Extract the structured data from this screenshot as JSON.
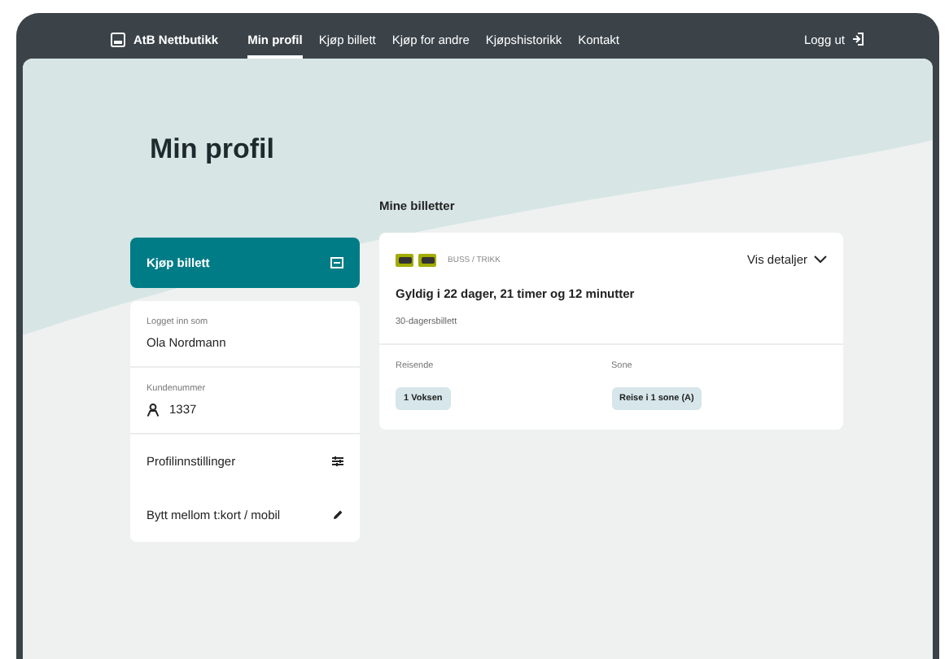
{
  "nav": {
    "brand": "AtB Nettbutikk",
    "links": [
      {
        "label": "Min profil",
        "selected": true
      },
      {
        "label": "Kjøp billett",
        "selected": false
      },
      {
        "label": "Kjøp for andre",
        "selected": false
      },
      {
        "label": "Kjøpshistorikk",
        "selected": false
      },
      {
        "label": "Kontakt",
        "selected": false
      }
    ],
    "logout": "Logg ut"
  },
  "title": "Min profil",
  "buy_button": "Kjøp billett",
  "profile": {
    "logged_in_label": "Logget inn som",
    "name": "Ola Nordmann",
    "customer_label": "Kundenummer",
    "customer_number": "1337",
    "actions": [
      {
        "kind": "settings",
        "label": "Profilinnstillinger"
      },
      {
        "kind": "edit",
        "label": "Bytt mellom t:kort / mobil"
      }
    ]
  },
  "tickets": {
    "heading": "Mine billetter",
    "mode": "BUSS / TRIKK",
    "details": "Vis detaljer",
    "validity": "Gyldig i 22 dager, 21 timer og 12 minutter",
    "product": "30-dagersbillett",
    "fields": [
      {
        "label": "Reisende",
        "value": "1 Voksen"
      },
      {
        "label": "Sone",
        "value": "Reise i 1 sone (A)"
      }
    ]
  }
}
